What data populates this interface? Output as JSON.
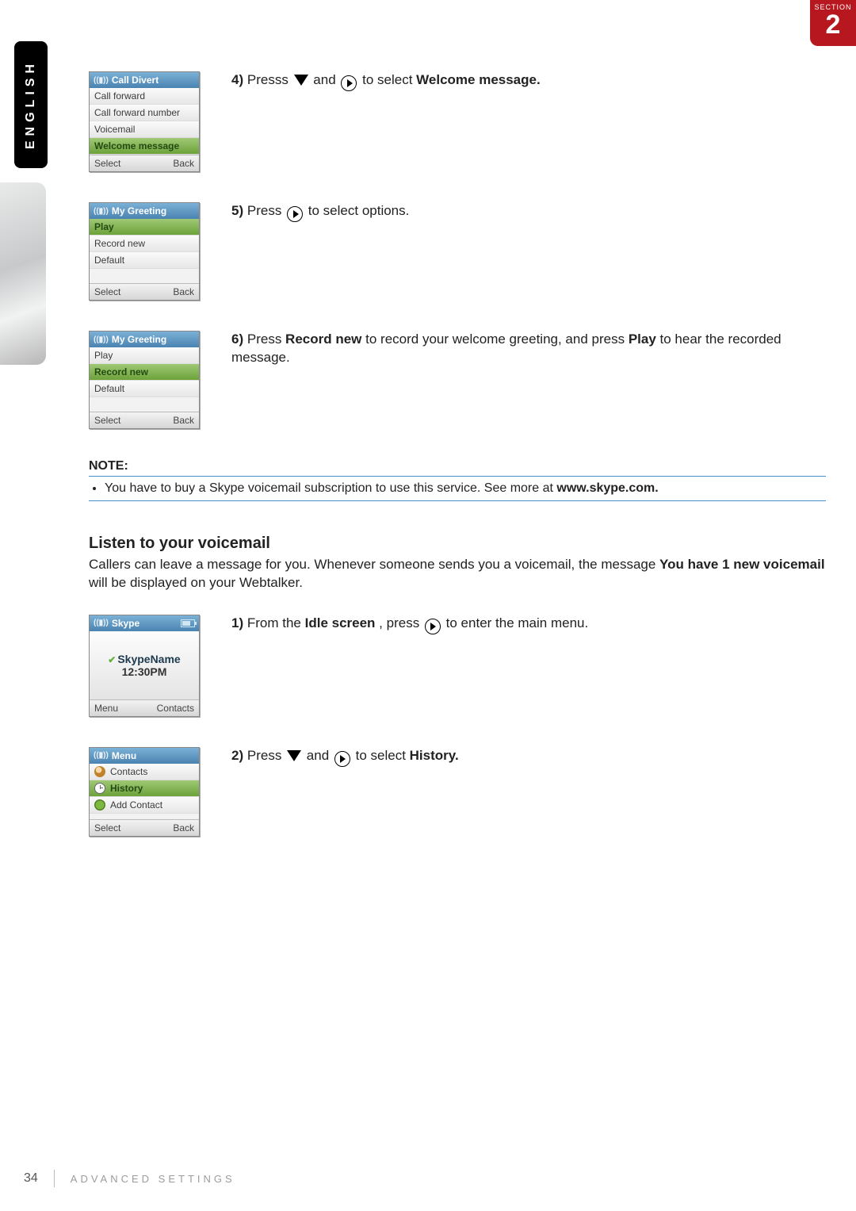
{
  "section": {
    "label": "SECTION",
    "number": "2"
  },
  "language_tab": "ENGLISH",
  "steps": {
    "s4": {
      "num": "4)",
      "pre": "Presss ",
      "mid": " and ",
      "post": " to select ",
      "bold": "Welcome message."
    },
    "s5": {
      "num": "5)",
      "pre": "Press ",
      "post": " to select options."
    },
    "s6": {
      "num": "6)",
      "t1": "Press ",
      "b1": "Record new",
      "t2": " to record your welcome greeting, and press ",
      "b2": "Play",
      "t3": " to hear the recorded message."
    },
    "s1": {
      "num": "1)",
      "t1": "From the ",
      "b1": "Idle screen",
      "t2": ", press ",
      "t3": " to enter the main menu."
    },
    "s2": {
      "num": "2)",
      "pre": "Press ",
      "mid": " and ",
      "post": " to select ",
      "bold": "History."
    }
  },
  "phones": {
    "call_divert": {
      "title": "Call Divert",
      "items": [
        "Call forward",
        "Call forward number",
        "Voicemail",
        "Welcome message"
      ],
      "selected": 3,
      "left": "Select",
      "right": "Back"
    },
    "greeting_play": {
      "title": "My Greeting",
      "items": [
        "Play",
        "Record new",
        "Default"
      ],
      "selected": 0,
      "left": "Select",
      "right": "Back"
    },
    "greeting_rec": {
      "title": "My Greeting",
      "items": [
        "Play",
        "Record new",
        "Default"
      ],
      "selected": 1,
      "left": "Select",
      "right": "Back"
    },
    "idle": {
      "title": "Skype",
      "name": "SkypeName",
      "time": "12:30PM",
      "left": "Menu",
      "right": "Contacts"
    },
    "menu": {
      "title": "Menu",
      "items": [
        {
          "icon": "contacts",
          "label": "Contacts"
        },
        {
          "icon": "history",
          "label": "History"
        },
        {
          "icon": "add",
          "label": "Add Contact"
        }
      ],
      "selected": 1,
      "left": "Select",
      "right": "Back"
    }
  },
  "note": {
    "heading": "NOTE:",
    "bullet_pre": "You have to buy a Skype voicemail subscription to use this service. See more at ",
    "bullet_bold": "www.skype.com."
  },
  "listen": {
    "heading": "Listen to your voicemail",
    "para_pre": "Callers can leave a message for you. Whenever someone sends you a voicemail, the message ",
    "para_bold": "You have 1 new voicemail",
    "para_post": " will be displayed on your Webtalker."
  },
  "footer": {
    "page": "34",
    "section": "ADVANCED SETTINGS"
  }
}
